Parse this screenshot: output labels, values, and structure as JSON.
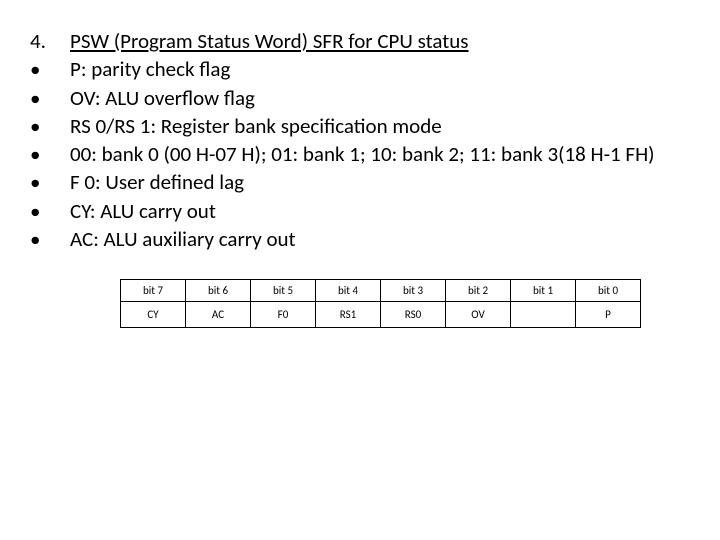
{
  "heading_number": "4.",
  "heading_text": "PSW (Program Status Word) SFR  for CPU status",
  "bullets": [
    "P: parity check flag",
    "OV: ALU overflow flag",
    "RS 0/RS 1: Register bank specification mode",
    "00: bank 0 (00 H-07 H); 01: bank 1; 10: bank 2; 11:  bank 3(18 H-1 FH)",
    "F 0:   User defined lag",
    "CY:  ALU carry out",
    "AC:  ALU auxiliary carry out"
  ],
  "chart_data": {
    "type": "table",
    "title": "",
    "headers": [
      "bit 7",
      "bit 6",
      "bit 5",
      "bit 4",
      "bit 3",
      "bit 2",
      "bit 1",
      "bit 0"
    ],
    "row": [
      "CY",
      "AC",
      "F0",
      "RS1",
      "RS0",
      "OV",
      "",
      "P"
    ]
  }
}
